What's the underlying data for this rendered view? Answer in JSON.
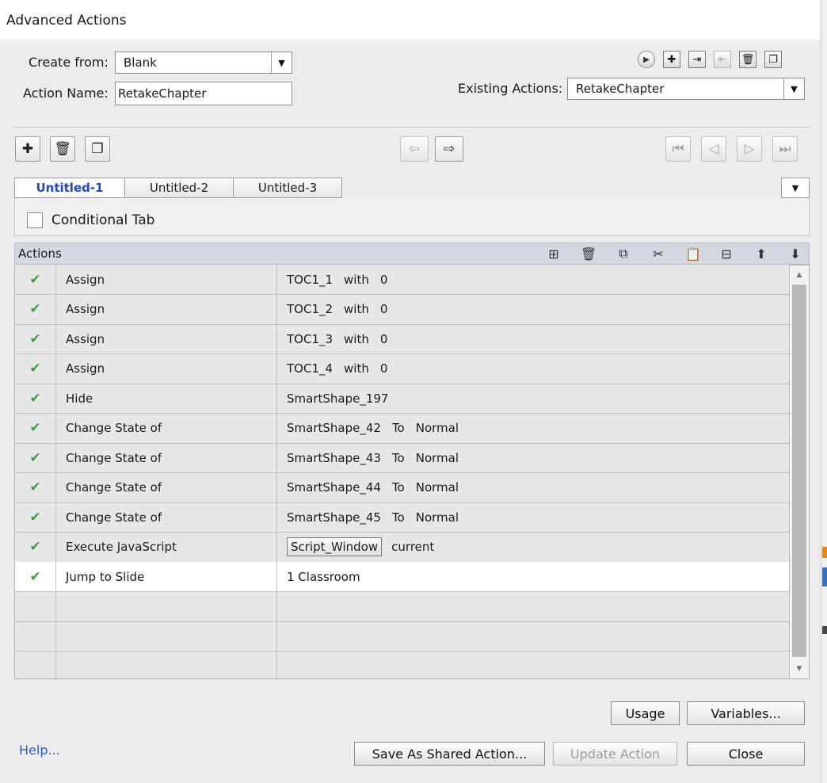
{
  "window": {
    "title": "Advanced Actions"
  },
  "form": {
    "create_from_label": "Create from:",
    "create_from_value": "Blank",
    "action_name_label": "Action Name:",
    "action_name_value": "RetakeChapter",
    "existing_actions_label": "Existing Actions:",
    "existing_actions_value": "RetakeChapter"
  },
  "tabs": [
    {
      "label": "Untitled-1",
      "active": true
    },
    {
      "label": "Untitled-2",
      "active": false
    },
    {
      "label": "Untitled-3",
      "active": false
    }
  ],
  "conditional_tab_label": "Conditional Tab",
  "actions_header": "Actions",
  "rows": [
    {
      "action": "Assign",
      "target": [
        "TOC1_1",
        "with",
        "0"
      ]
    },
    {
      "action": "Assign",
      "target": [
        "TOC1_2",
        "with",
        "0"
      ]
    },
    {
      "action": "Assign",
      "target": [
        "TOC1_3",
        "with",
        "0"
      ]
    },
    {
      "action": "Assign",
      "target": [
        "TOC1_4",
        "with",
        "0"
      ]
    },
    {
      "action": "Hide",
      "target": [
        "SmartShape_197"
      ]
    },
    {
      "action": "Change State of",
      "target": [
        "SmartShape_42",
        "To",
        "Normal"
      ]
    },
    {
      "action": "Change State of",
      "target": [
        "SmartShape_43",
        "To",
        "Normal"
      ]
    },
    {
      "action": "Change State of",
      "target": [
        "SmartShape_44",
        "To",
        "Normal"
      ]
    },
    {
      "action": "Change State of",
      "target": [
        "SmartShape_45",
        "To",
        "Normal"
      ]
    },
    {
      "action": "Execute JavaScript",
      "script_button": "Script_Window",
      "target": [
        "current"
      ]
    },
    {
      "action": "Jump to Slide",
      "target": [
        "1 Classroom"
      ],
      "selected": true
    }
  ],
  "empty_rows": 3,
  "buttons": {
    "usage": "Usage",
    "variables": "Variables...",
    "save_shared": "Save As Shared Action...",
    "update_action": "Update Action",
    "close": "Close"
  },
  "help_link": "Help...",
  "colors": {
    "check": "#3fa13b",
    "active_tab": "#1b49c8",
    "help_link": "#2a62c9"
  },
  "icons": {
    "top_right": [
      "play-icon",
      "add-icon",
      "import-icon",
      "export-icon",
      "delete-icon",
      "duplicate-icon"
    ],
    "toolbar_left": [
      "add-icon",
      "delete-icon",
      "duplicate-icon"
    ],
    "toolbar_mid": [
      "import-block-icon",
      "export-block-icon"
    ],
    "toolbar_nav": [
      "first-icon",
      "prev-icon",
      "next-icon",
      "last-icon"
    ],
    "actions_tools": [
      "insert-row-icon",
      "delete-row-icon",
      "copy-icon",
      "cut-icon",
      "paste-icon",
      "insert-below-icon",
      "move-up-icon",
      "move-down-icon"
    ]
  }
}
